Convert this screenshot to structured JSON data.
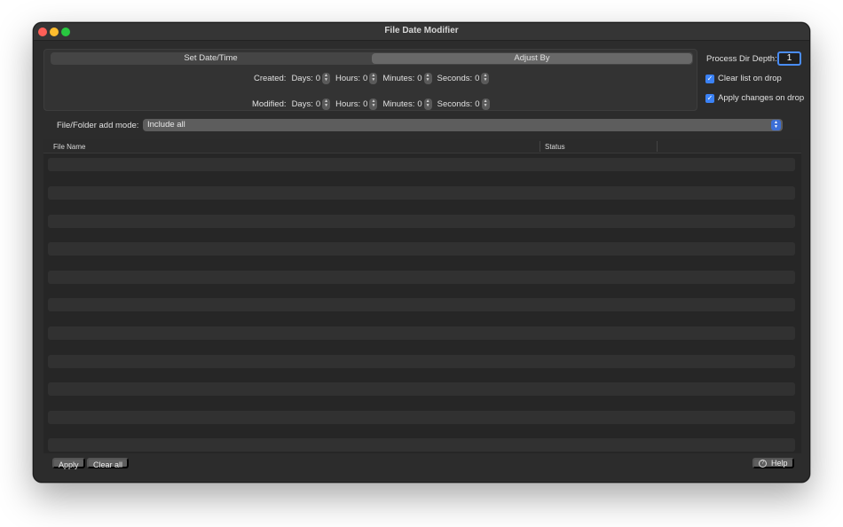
{
  "window": {
    "title": "File Date Modifier"
  },
  "mode_tabs": [
    {
      "label": "Set Date/Time",
      "active": false
    },
    {
      "label": "Adjust By",
      "active": true
    }
  ],
  "adjust": {
    "created": {
      "label": "Created:",
      "days_label": "Days:",
      "days": "0",
      "hours_label": "Hours:",
      "hours": "0",
      "minutes_label": "Minutes:",
      "minutes": "0",
      "seconds_label": "Seconds:",
      "seconds": "0"
    },
    "modified": {
      "label": "Modified:",
      "days_label": "Days:",
      "days": "0",
      "hours_label": "Hours:",
      "hours": "0",
      "minutes_label": "Minutes:",
      "minutes": "0",
      "seconds_label": "Seconds:",
      "seconds": "0"
    }
  },
  "options": {
    "depth_label": "Process Dir Depth:",
    "depth_value": "1",
    "clear_list_label": "Clear list on drop",
    "clear_list_checked": true,
    "apply_changes_label": "Apply changes on drop",
    "apply_changes_checked": true
  },
  "add_mode": {
    "label": "File/Folder add mode:",
    "selected": "Include all"
  },
  "table": {
    "columns": [
      "File Name",
      "Status"
    ],
    "rows": []
  },
  "buttons": {
    "apply": "Apply",
    "clear_all": "Clear all",
    "help": "Help"
  },
  "icons": {
    "help": "question-circle-icon",
    "stepper": "stepper-icon",
    "checkbox": "checkmark-icon",
    "popup": "popup-chevrons-icon"
  },
  "colors": {
    "accent": "#3b82f6",
    "window_bg": "#2c2c2c",
    "close": "#fe5f57",
    "minimize": "#febc2e",
    "maximize": "#28c840"
  }
}
